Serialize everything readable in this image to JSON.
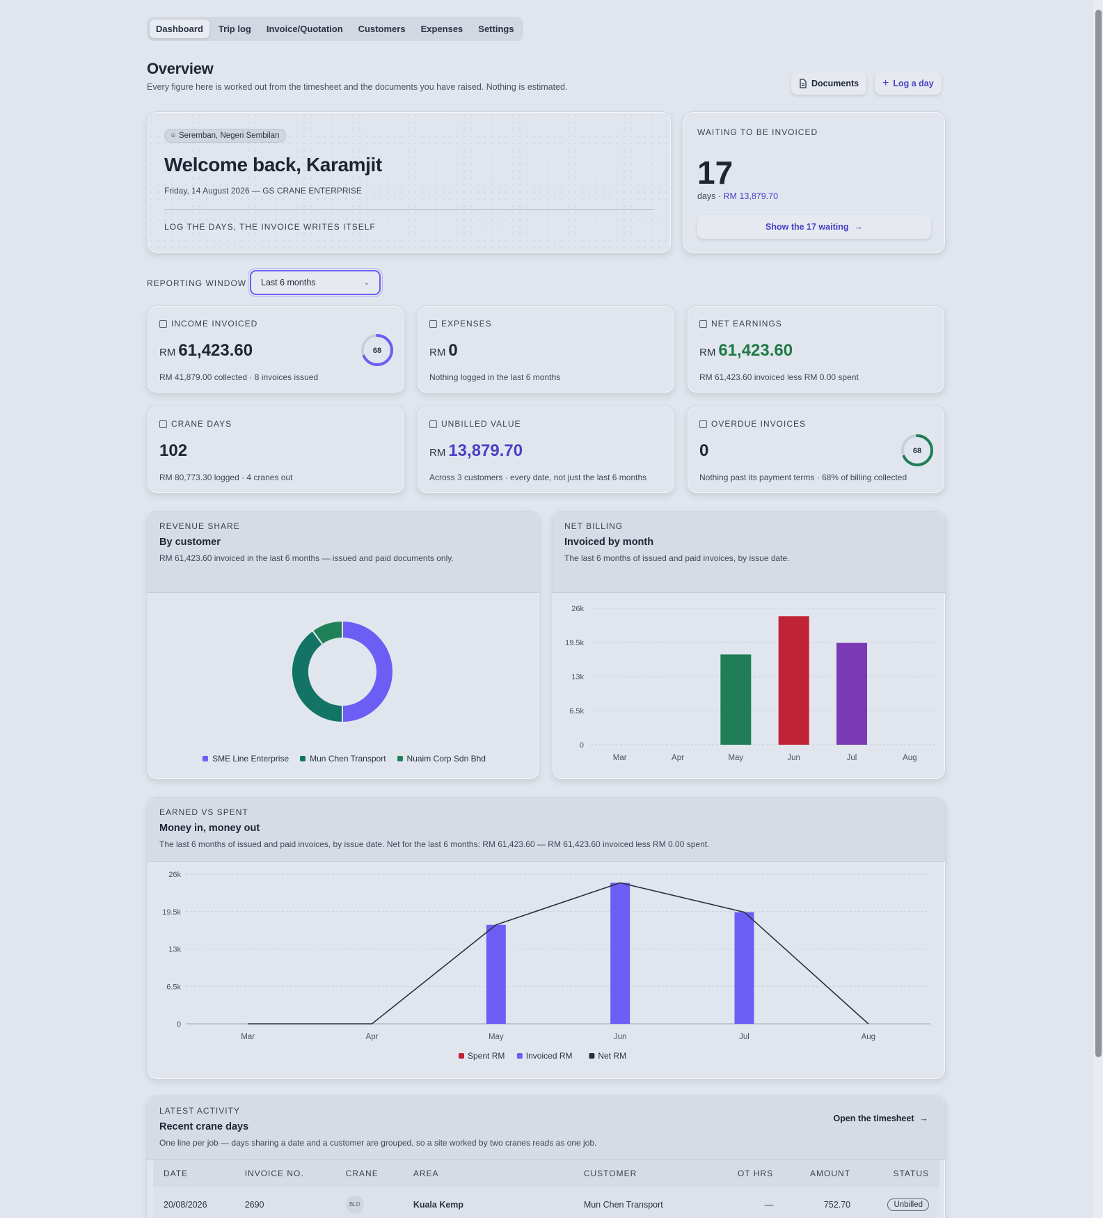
{
  "nav": {
    "tabs": [
      "Dashboard",
      "Trip log",
      "Invoice/Quotation",
      "Customers",
      "Expenses",
      "Settings"
    ]
  },
  "header": {
    "title": "Overview",
    "subtitle": "Every figure here is worked out from the timesheet and the documents you have raised. Nothing is estimated.",
    "documents_label": "Documents",
    "log_day_label": "Log a day"
  },
  "welcome": {
    "location": "Seremban, Negeri Sembilan",
    "greeting": "Welcome back, Karamjit",
    "date_line": "Friday, 14 August 2026 — GS CRANE ENTERPRISE",
    "tagline": "LOG THE DAYS, THE INVOICE WRITES ITSELF"
  },
  "waiting": {
    "label": "WAITING TO BE INVOICED",
    "count": "17",
    "unit": "days ·",
    "amount": "RM 13,879.70",
    "button": "Show the 17 waiting"
  },
  "reporting": {
    "label": "REPORTING WINDOW",
    "selected": "Last 6 months"
  },
  "stats": {
    "income": {
      "label": "INCOME INVOICED",
      "currency": "RM",
      "value": "61,423.60",
      "foot": "RM 41,879.00 collected · 8 invoices issued",
      "ring": "68",
      "ring_fraction": 0.68
    },
    "expenses": {
      "label": "EXPENSES",
      "currency": "RM",
      "value": "0",
      "foot": "Nothing logged in the last 6 months"
    },
    "net": {
      "label": "NET EARNINGS",
      "currency": "RM",
      "value": "61,423.60",
      "foot": "RM 61,423.60 invoiced less RM 0.00 spent"
    },
    "crane": {
      "label": "CRANE DAYS",
      "value": "102",
      "foot": "RM 80,773.30 logged · 4 cranes out"
    },
    "unbilled": {
      "label": "UNBILLED VALUE",
      "currency": "RM",
      "value": "13,879.70",
      "foot": "Across 3 customers · every date, not just the last 6 months"
    },
    "overdue": {
      "label": "OVERDUE INVOICES",
      "value": "0",
      "foot": "Nothing past its payment terms · 68% of billing collected",
      "ring": "68",
      "ring_fraction": 0.68
    }
  },
  "revenue": {
    "label": "REVENUE SHARE",
    "title": "By customer",
    "sub": "RM 61,423.60 invoiced in the last 6 months — issued and paid documents only."
  },
  "billing": {
    "label": "NET BILLING",
    "title": "Invoiced by month",
    "sub": "The last 6 months of issued and paid invoices, by issue date."
  },
  "earned": {
    "label": "EARNED VS SPENT",
    "title": "Money in, money out",
    "sub": "The last 6 months of issued and paid invoices, by issue date. Net for the last 6 months: RM 61,423.60 — RM 61,423.60 invoiced less RM 0.00 spent."
  },
  "chart_data": [
    {
      "type": "pie",
      "categories": [
        "SME Line Enterprise",
        "Mun Chen Transport",
        "Nuaim Corp Sdn Bhd"
      ],
      "values": [
        50,
        40,
        10
      ],
      "colors": [
        "#6c5ef5",
        "#137466",
        "#208158"
      ]
    },
    {
      "type": "bar",
      "categories": [
        "Mar",
        "Apr",
        "May",
        "Jun",
        "Jul",
        "Aug"
      ],
      "values": [
        0,
        0,
        17200,
        24500,
        19400,
        0
      ],
      "colors": [
        "#1f7e57",
        "#1f7e57",
        "#1f7e57",
        "#c02236",
        "#7b3ab3",
        "#7b3ab3"
      ],
      "yticks": [
        "0",
        "6.5k",
        "13k",
        "19.5k",
        "26k"
      ],
      "ylim": [
        0,
        26000
      ]
    },
    {
      "type": "bar",
      "categories": [
        "Mar",
        "Apr",
        "May",
        "Jun",
        "Jul",
        "Aug"
      ],
      "series": [
        {
          "name": "Spent RM",
          "values": [
            0,
            0,
            0,
            0,
            0,
            0
          ],
          "color": "#c02236"
        },
        {
          "name": "Invoiced RM",
          "values": [
            0,
            0,
            17200,
            24500,
            19400,
            0
          ],
          "color": "#6c5ef5"
        },
        {
          "name": "Net RM",
          "values": [
            0,
            0,
            17200,
            24500,
            19400,
            0
          ],
          "color": "#2a2f3d"
        }
      ],
      "yticks": [
        "0",
        "6.5k",
        "13k",
        "19.5k",
        "26k"
      ],
      "ylim": [
        0,
        26000
      ]
    }
  ],
  "activity": {
    "label": "LATEST ACTIVITY",
    "title": "Recent crane days",
    "sub": "One line per job — days sharing a date and a customer are grouped, so a site worked by two cranes reads as one job.",
    "open_label": "Open the timesheet",
    "columns": [
      "DATE",
      "INVOICE NO.",
      "CRANE",
      "AREA",
      "CUSTOMER",
      "OT HRS",
      "AMOUNT",
      "STATUS"
    ],
    "rows": [
      {
        "date": "20/08/2026",
        "invoice": "2690",
        "crane": "BLD",
        "area": "Kuala Kemp",
        "customer": "Mun Chen Transport",
        "ot": "—",
        "amount": "752.70",
        "status": "Unbilled"
      }
    ]
  }
}
